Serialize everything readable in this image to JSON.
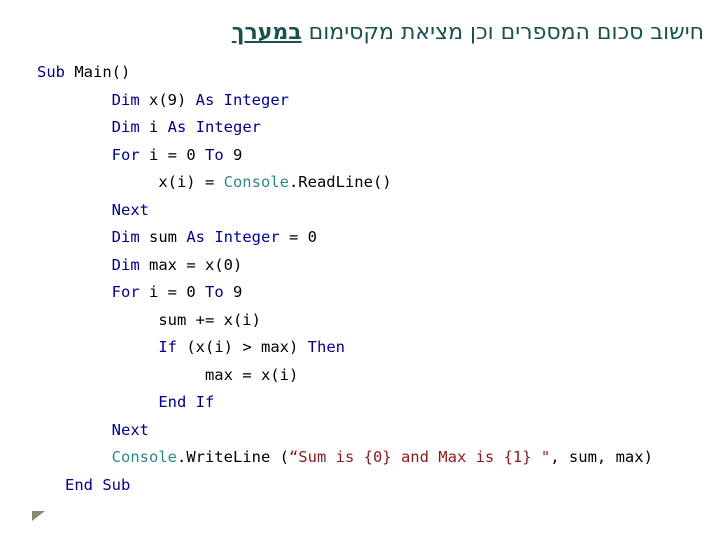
{
  "title": {
    "text": "חישוב סכום המספרים וכן מציאת מקסימום ",
    "emphasis": "במערך"
  },
  "code": {
    "language": "VB.NET",
    "lines": [
      [
        {
          "t": "Sub",
          "c": "kw"
        },
        {
          "t": " Main()"
        }
      ],
      [
        {
          "t": "        "
        },
        {
          "t": "Dim",
          "c": "kw"
        },
        {
          "t": " x(9) "
        },
        {
          "t": "As",
          "c": "kw"
        },
        {
          "t": " "
        },
        {
          "t": "Integer",
          "c": "kw"
        }
      ],
      [
        {
          "t": "        "
        },
        {
          "t": "Dim",
          "c": "kw"
        },
        {
          "t": " i "
        },
        {
          "t": "As",
          "c": "kw"
        },
        {
          "t": " "
        },
        {
          "t": "Integer",
          "c": "kw"
        }
      ],
      [
        {
          "t": "        "
        },
        {
          "t": "For",
          "c": "kw"
        },
        {
          "t": " i = 0 "
        },
        {
          "t": "To",
          "c": "kw"
        },
        {
          "t": " 9"
        }
      ],
      [
        {
          "t": "             x(i) = "
        },
        {
          "t": "Console",
          "c": "cls"
        },
        {
          "t": ".ReadLine()"
        }
      ],
      [
        {
          "t": "        "
        },
        {
          "t": "Next",
          "c": "kw"
        }
      ],
      [
        {
          "t": "        "
        },
        {
          "t": "Dim",
          "c": "kw"
        },
        {
          "t": " sum "
        },
        {
          "t": "As",
          "c": "kw"
        },
        {
          "t": " "
        },
        {
          "t": "Integer",
          "c": "kw"
        },
        {
          "t": " = 0"
        }
      ],
      [
        {
          "t": "        "
        },
        {
          "t": "Dim",
          "c": "kw"
        },
        {
          "t": " max = x(0)"
        }
      ],
      [
        {
          "t": "        "
        },
        {
          "t": "For",
          "c": "kw"
        },
        {
          "t": " i = 0 "
        },
        {
          "t": "To",
          "c": "kw"
        },
        {
          "t": " 9"
        }
      ],
      [
        {
          "t": "             sum += x(i)"
        }
      ],
      [
        {
          "t": "             "
        },
        {
          "t": "If",
          "c": "kw"
        },
        {
          "t": " (x(i) > max) "
        },
        {
          "t": "Then",
          "c": "kw"
        }
      ],
      [
        {
          "t": "                  max = x(i)"
        }
      ],
      [
        {
          "t": "             "
        },
        {
          "t": "End If",
          "c": "kw"
        }
      ],
      [
        {
          "t": "        "
        },
        {
          "t": "Next",
          "c": "kw"
        }
      ],
      [
        {
          "t": "        "
        },
        {
          "t": "Console",
          "c": "cls"
        },
        {
          "t": ".WriteLine ("
        },
        {
          "t": "“Sum is {0} and Max is {1} \"",
          "c": "str"
        },
        {
          "t": ", sum, max)"
        }
      ],
      [
        {
          "t": "   "
        },
        {
          "t": "End Sub",
          "c": "kw"
        }
      ]
    ]
  },
  "colors": {
    "title": "#17524f",
    "keyword": "#00008b",
    "class": "#2b8a8a",
    "string": "#8b1a1a",
    "text": "#000000"
  }
}
